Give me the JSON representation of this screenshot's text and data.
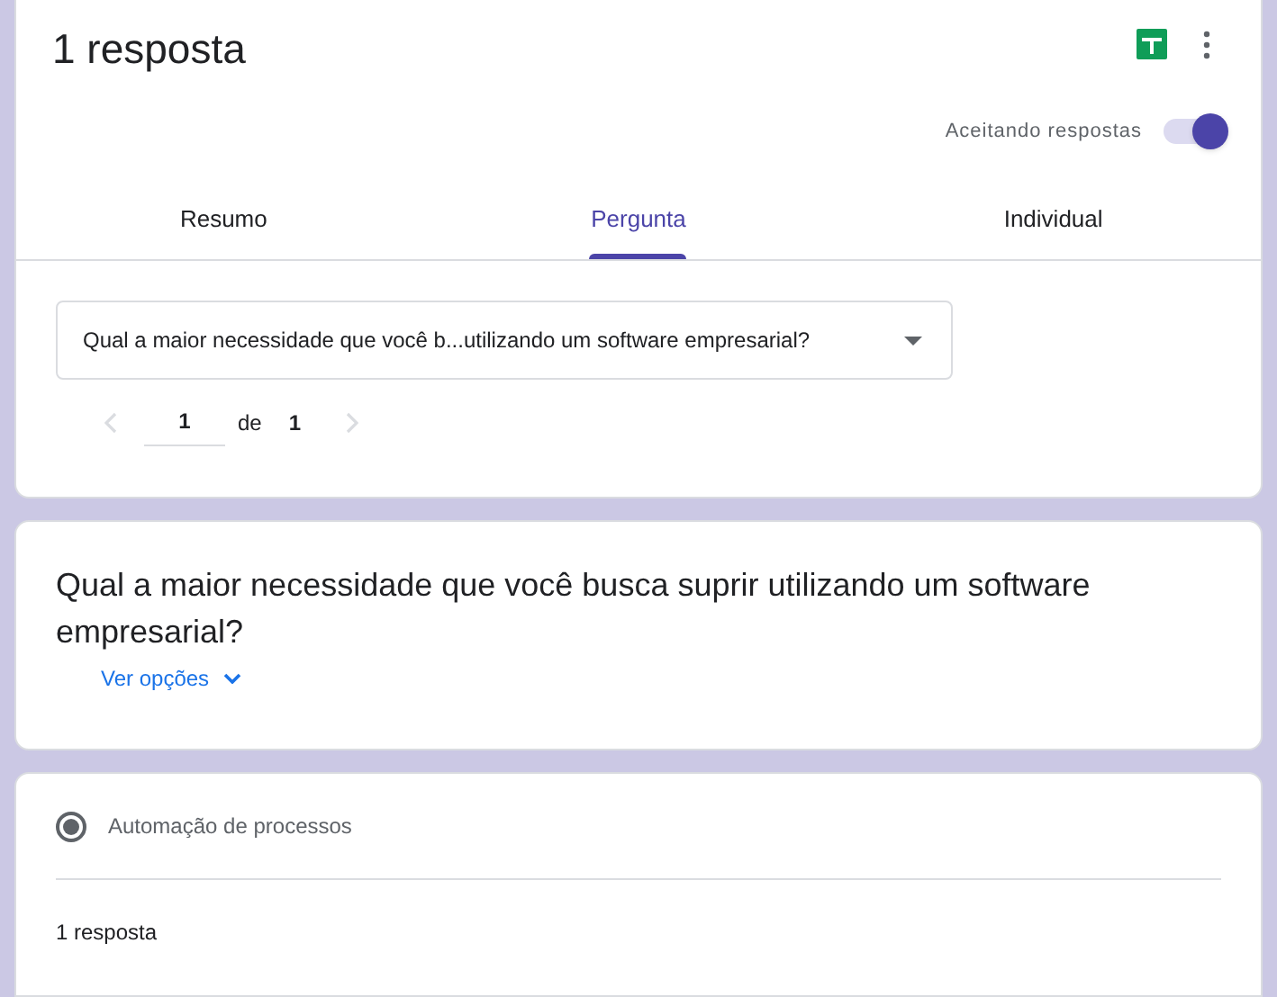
{
  "header": {
    "title": "1 resposta",
    "accepting": {
      "label": "Aceitando respostas",
      "on": true
    }
  },
  "tabs": [
    {
      "label": "Resumo",
      "selected": false
    },
    {
      "label": "Pergunta",
      "selected": true
    },
    {
      "label": "Individual",
      "selected": false
    }
  ],
  "question_select": {
    "value": "Qual a maior necessidade que você b...utilizando um software empresarial?"
  },
  "pager": {
    "current": "1",
    "separator": "de",
    "total": "1"
  },
  "question": {
    "title": "Qual a maior necessidade que você busca suprir utilizando um software empresarial?",
    "options_link": "Ver opções"
  },
  "answer": {
    "options": [
      {
        "label": "Automação de processos",
        "selected": true
      }
    ],
    "count": "1 resposta"
  }
}
